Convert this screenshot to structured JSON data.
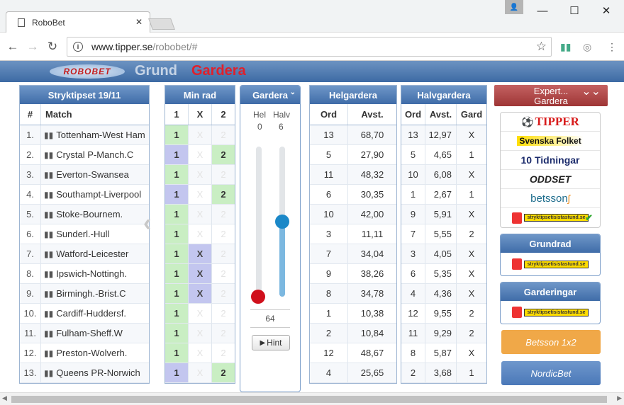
{
  "browser": {
    "tab_title": "RoboBet",
    "url_host": "www.tipper.se",
    "url_path": "/robobet/#"
  },
  "banner": {
    "logo": "ROBOBET",
    "grund": "Grund",
    "gardera": "Gardera"
  },
  "match_panel": {
    "title": "Stryktipset 19/11",
    "col_num": "#",
    "col_match": "Match",
    "rows": [
      {
        "n": "1.",
        "m": "Tottenham-West Ham"
      },
      {
        "n": "2.",
        "m": "Crystal P-Manch.C"
      },
      {
        "n": "3.",
        "m": "Everton-Swansea"
      },
      {
        "n": "4.",
        "m": "Southampt-Liverpool"
      },
      {
        "n": "5.",
        "m": "Stoke-Bournem."
      },
      {
        "n": "6.",
        "m": "Sunderl.-Hull"
      },
      {
        "n": "7.",
        "m": "Watford-Leicester"
      },
      {
        "n": "8.",
        "m": "Ipswich-Nottingh."
      },
      {
        "n": "9.",
        "m": "Birmingh.-Brist.C"
      },
      {
        "n": "10.",
        "m": "Cardiff-Huddersf."
      },
      {
        "n": "11.",
        "m": "Fulham-Sheff.W"
      },
      {
        "n": "12.",
        "m": "Preston-Wolverh."
      },
      {
        "n": "13.",
        "m": "Queens PR-Norwich"
      }
    ]
  },
  "minrad": {
    "title": "Min rad",
    "h1": "1",
    "hx": "X",
    "h2": "2",
    "rows": [
      [
        "1",
        "X",
        "2"
      ],
      [
        "1",
        "X",
        "2"
      ],
      [
        "1",
        "X",
        "2"
      ],
      [
        "1",
        "X",
        "2"
      ],
      [
        "1",
        "X",
        "2"
      ],
      [
        "1",
        "X",
        "2"
      ],
      [
        "1",
        "X",
        "2"
      ],
      [
        "1",
        "X",
        "2"
      ],
      [
        "1",
        "X",
        "2"
      ],
      [
        "1",
        "X",
        "2"
      ],
      [
        "1",
        "X",
        "2"
      ],
      [
        "1",
        "X",
        "2"
      ],
      [
        "1",
        "X",
        "2"
      ]
    ],
    "state": [
      [
        "g",
        "",
        ""
      ],
      [
        "b",
        "",
        "on"
      ],
      [
        "g",
        "",
        ""
      ],
      [
        "b",
        "",
        "on"
      ],
      [
        "g",
        "",
        ""
      ],
      [
        "g",
        "",
        ""
      ],
      [
        "g",
        "on",
        ""
      ],
      [
        "g",
        "on",
        ""
      ],
      [
        "g",
        "on",
        ""
      ],
      [
        "g",
        "",
        ""
      ],
      [
        "g",
        "",
        ""
      ],
      [
        "g",
        "",
        ""
      ],
      [
        "b",
        "",
        "on"
      ]
    ]
  },
  "gardera": {
    "title": "Gardera",
    "hel_label": "Hel",
    "halv_label": "Halv",
    "hel_value": "0",
    "halv_value": "6",
    "total": "64",
    "hint": "Hint",
    "hel_level": 0,
    "halv_level": 0.5
  },
  "helgardera": {
    "title": "Helgardera",
    "col_ord": "Ord",
    "col_avst": "Avst.",
    "rows": [
      [
        "13",
        "68,70"
      ],
      [
        "5",
        "27,90"
      ],
      [
        "11",
        "48,32"
      ],
      [
        "6",
        "30,35"
      ],
      [
        "10",
        "42,00"
      ],
      [
        "3",
        "11,11"
      ],
      [
        "7",
        "34,04"
      ],
      [
        "9",
        "38,26"
      ],
      [
        "8",
        "34,78"
      ],
      [
        "1",
        "10,38"
      ],
      [
        "2",
        "10,84"
      ],
      [
        "12",
        "48,67"
      ],
      [
        "4",
        "25,65"
      ]
    ]
  },
  "halvgardera": {
    "title": "Halvgardera",
    "col_ord": "Ord",
    "col_avst": "Avst.",
    "col_gard": "Gard",
    "rows": [
      [
        "13",
        "12,97",
        "X"
      ],
      [
        "5",
        "4,65",
        "1"
      ],
      [
        "10",
        "6,08",
        "X"
      ],
      [
        "1",
        "2,67",
        "1"
      ],
      [
        "9",
        "5,91",
        "X"
      ],
      [
        "7",
        "5,55",
        "2"
      ],
      [
        "3",
        "4,05",
        "X"
      ],
      [
        "6",
        "5,35",
        "X"
      ],
      [
        "4",
        "4,36",
        "X"
      ],
      [
        "12",
        "9,55",
        "2"
      ],
      [
        "11",
        "9,29",
        "2"
      ],
      [
        "8",
        "5,87",
        "X"
      ],
      [
        "2",
        "3,68",
        "1"
      ]
    ]
  },
  "expert": {
    "line1": "Expert...",
    "line2": "Gardera"
  },
  "brands": [
    "TIPPER",
    "Svenska Folket",
    "10 Tidningar",
    "ODDSET",
    "betsson",
    "stryktipsetisistastund.se"
  ],
  "grundrad": {
    "title": "Grundrad",
    "logo": "stryktipsetisistastund.se"
  },
  "garderingar": {
    "title": "Garderingar",
    "logo": "stryktipsetisistastund.se"
  },
  "buttons": {
    "betsson": "Betsson 1x2",
    "nordicbet": "NordicBet"
  },
  "colors": {
    "header_blue": "#3f6ca8",
    "green": "#c9eec3",
    "purple": "#c3c6ef",
    "red_knob": "#d0101c",
    "blue_knob": "#1b88c8",
    "betsson": "#f0a848",
    "nordicbet": "#5a86c0"
  }
}
